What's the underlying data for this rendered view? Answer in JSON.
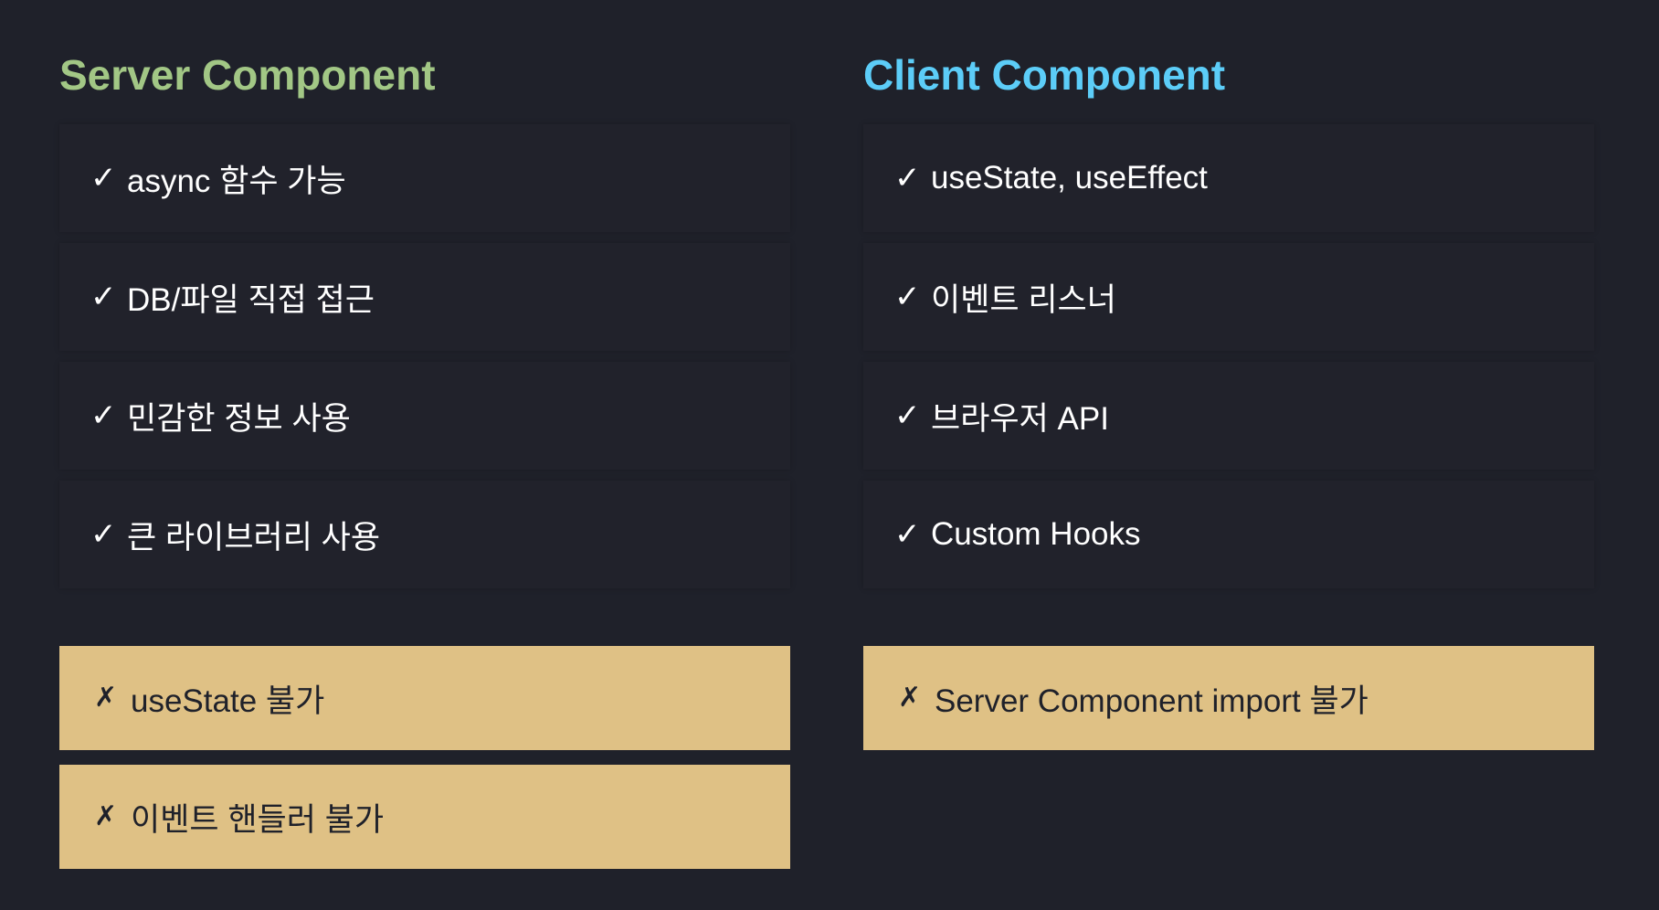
{
  "server": {
    "title": "Server Component",
    "pros": [
      "async 함수 가능",
      "DB/파일 직접 접근",
      "민감한 정보 사용",
      "큰 라이브러리 사용"
    ],
    "cons": [
      "useState 불가",
      "이벤트 핸들러 불가"
    ]
  },
  "client": {
    "title": "Client Component",
    "pros": [
      "useState, useEffect",
      "이벤트 리스너",
      "브라우저 API",
      "Custom Hooks"
    ],
    "cons": [
      "Server Component import 불가"
    ]
  },
  "marks": {
    "check": "✓",
    "cross": "✗"
  },
  "colors": {
    "background": "#1f212a",
    "server_title": "#a2c785",
    "client_title": "#5ccdf8",
    "card": "#21222b",
    "warning": "#dfc185",
    "text_light": "#ffffff",
    "text_dark": "#1f212a"
  }
}
